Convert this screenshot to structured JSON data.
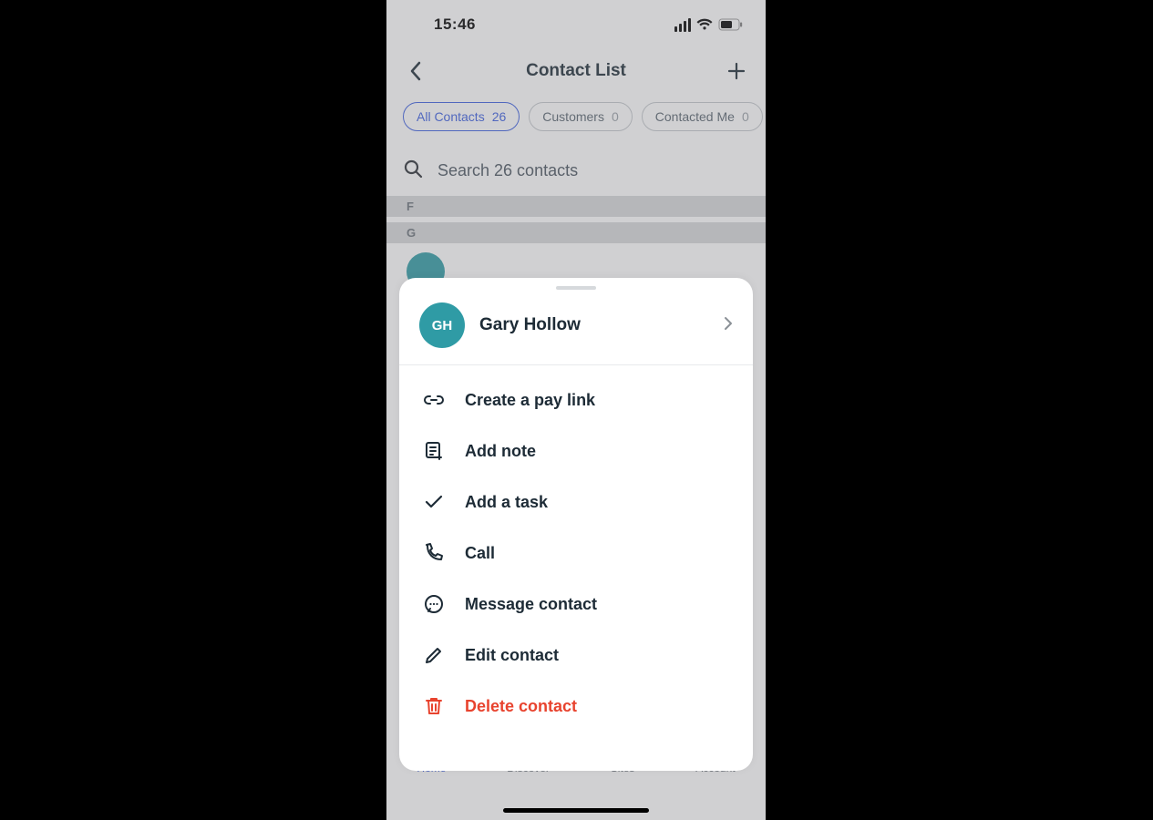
{
  "status": {
    "time": "15:46"
  },
  "header": {
    "title": "Contact List"
  },
  "filters": [
    {
      "label": "All Contacts",
      "count": "26"
    },
    {
      "label": "Customers",
      "count": "0"
    },
    {
      "label": "Contacted Me",
      "count": "0"
    }
  ],
  "search": {
    "placeholder": "Search 26 contacts"
  },
  "sections": [
    "F",
    "G"
  ],
  "tabs": [
    "Home",
    "Discover",
    "Sites",
    "Account"
  ],
  "sheet": {
    "initials": "GH",
    "name": "Gary Hollow",
    "actions": [
      {
        "label": "Create a pay link"
      },
      {
        "label": "Add note"
      },
      {
        "label": "Add a task"
      },
      {
        "label": "Call"
      },
      {
        "label": "Message contact"
      },
      {
        "label": "Edit contact"
      },
      {
        "label": "Delete contact"
      }
    ]
  }
}
